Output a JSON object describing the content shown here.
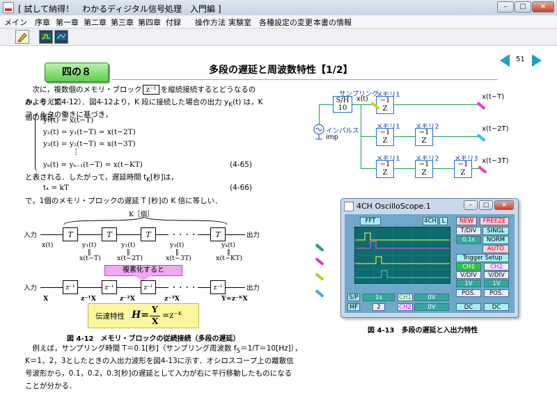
{
  "window": {
    "title": "[ 試して納得！　わかるディジタル信号処理　入門編 ]",
    "controls": {
      "minimize": "–",
      "maximize": "□",
      "close": "×"
    }
  },
  "menu": [
    "メイン",
    "序章",
    "第一章",
    "第二章",
    "第三章",
    "第四章",
    "付録",
    "操作方法",
    "実験室",
    "各種設定の変更",
    "本書の情報"
  ],
  "toolbar": {
    "tools": [
      "pencil-icon",
      "scope-icon",
      "monitor-icon"
    ]
  },
  "page": {
    "chapter": "四の８",
    "title": "多段の遅延と周波数特性【1/2】",
    "page_number": "51",
    "accent": "#1aa3c9"
  },
  "text": {
    "intro_1": "次に，複数個のメモリ・ブロック",
    "intro_block": "z⁻¹",
    "intro_2": "を縦続接続するとどうなるのか，考えて",
    "line_2": "みよう（図4-12）．図4-12より，K 段に接続した場合の出力 y",
    "line_2_sub": "K",
    "line_2b": "(t) は，K個の遅延",
    "line_3": "フィルタの働きに基づき，",
    "eq_1": "y₁(t) = x(t−T)",
    "eq_2": "y₂(t) = y₁(t−T) = x(t−2T)",
    "eq_3": "y₃(t) = y₂(t−T) = x(t−3T)",
    "eq_dots": "⋮",
    "eq_k": "yₖ(t) = yₖ₋₁(t−T) = x(t−KT)",
    "eq_no_1": "(4-65)",
    "after_eq": "と表される．したがって，遅延時間 t",
    "after_eq_sub": "K",
    "after_eq_2": "[秒]は，",
    "eq_tk": "tₖ = kT",
    "eq_no_2": "(4-66)",
    "conclusion": "で，1個のメモリ・ブロックの遅延 T [秒]の K 倍に等しい．",
    "bottom_1": "例えば，サンプリング時間 T＝0.1[秒]（サンプリング周波数 f",
    "bottom_1_sub": "S",
    "bottom_1b": "＝1/T＝10[Hz]），",
    "bottom_2": "K＝1，2，3としたときの入出力波形を図4-13に示す．オシロスコープ上の離散信",
    "bottom_3": "号波形から，0.1，0.2，0.3[秒]の遅延として入力が右に平行移動したものになる",
    "bottom_4": "ことが分かる．"
  },
  "figure_12": {
    "caption": "図 4-12　メモリ・ブロックの従続接続（多段の遅延）",
    "k_label": "K［個］",
    "input": "入力",
    "output": "出力",
    "block": "T",
    "signals": [
      "x(t)",
      "y₁(t)",
      "y₂(t)",
      "y₃(t)",
      "yₖ(t)"
    ],
    "signals_eq": [
      "x(t−T)",
      "x(t−2T)",
      "x(t−3T)",
      "x(t−KT)"
    ],
    "equals": "‖",
    "dots": "・・・・",
    "transform": "複素化すると",
    "z_block": "z⁻¹",
    "z_in": "X",
    "z_outs": [
      "z⁻¹X",
      "z⁻²X",
      "z⁻³X",
      "Y=z⁻ᴷX"
    ],
    "transfer_label": "伝達特性",
    "transfer_eq_lhs": "H=",
    "transfer_num": "Y",
    "transfer_den": "X",
    "transfer_rhs": "=z⁻ᴷ"
  },
  "figure_13": {
    "caption": "図 4-13　多段の遅延と入出力特性",
    "sampler": {
      "label": "サンプリング",
      "box_1": "S/H",
      "box_2": "10"
    },
    "xt": "x(t)",
    "memories": [
      "メモリ1",
      "メモリ1",
      "メモリ2",
      "メモリ1",
      "メモリ2",
      "メモリ3"
    ],
    "z_block": "−1",
    "z_letter": "Z",
    "impulse": "インパルス",
    "imp": "imp",
    "outputs": [
      "x(t−T)",
      "x(t−2T)",
      "x(t−3T)"
    ],
    "probe_colors": [
      "#e83bd0",
      "#23c6e8",
      "#e83bd0"
    ]
  },
  "oscilloscope": {
    "title": "4CH OscilloScope.1",
    "buttons": {
      "fft": "FFT",
      "ch4": "4CH",
      "l": "L",
      "new": "NEW",
      "freeze": "FREEZE",
      "tdiv": "T/DIV",
      "singl": "SINGL",
      "tdiv_val": "0.1s",
      "norm": "NORM",
      "auto": "AUTO",
      "trigger": "Trigger Setup",
      "ch1": "CH1",
      "ch2": "CH2",
      "vdiv": "V/DIV",
      "vdiv1": "1V",
      "vdiv2": "1V",
      "pos": "POS.",
      "dc": "DC",
      "sp": "S/P",
      "mf": "MF",
      "time_val": "1s",
      "ch1_val": "0V",
      "ch2_val": "0V",
      "ch1_lbl": "CH1",
      "ch2_lbl": "CH2",
      "step": "2"
    },
    "trace_colors": [
      "#ffff40",
      "#ff50ff",
      "#ffff40",
      "#40d0ff"
    ]
  }
}
